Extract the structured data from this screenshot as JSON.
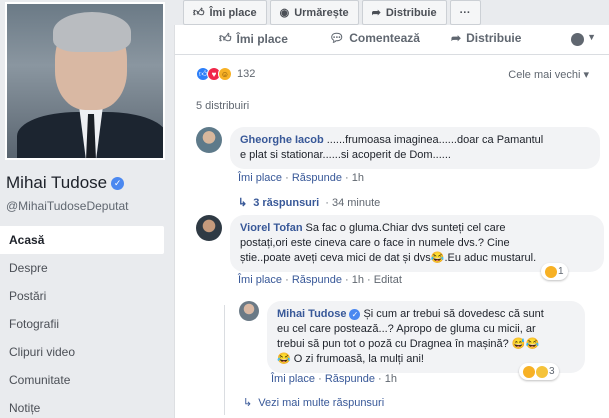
{
  "page": {
    "name": "Mihai Tudose",
    "handle": "@MihaiTudoseDeputat",
    "nav": [
      "Acasă",
      "Despre",
      "Postări",
      "Fotografii",
      "Clipuri video",
      "Comunitate",
      "Notițe"
    ]
  },
  "top_bar": {
    "like": "Îmi place",
    "follow": "Urmărește",
    "share": "Distribuie",
    "more": "···"
  },
  "post": {
    "actions": {
      "like": "Îmi place",
      "comment": "Comentează",
      "share": "Distribuie"
    },
    "reactions_count": "132",
    "sort": "Cele mai vechi ▾",
    "shares": "5 distribuiri"
  },
  "comments": [
    {
      "author": "Gheorghe Iacob",
      "text_line1": "......frumoasa imaginea......doar ca Pamantul",
      "text_line2": "e plat si stationar......si acoperit de Dom......",
      "like": "Îmi place",
      "reply": "Răspunde",
      "time": "1h",
      "replies_link": "3 răspunsuri",
      "replies_time": "· 34 minute"
    },
    {
      "author": "Viorel Tofan",
      "text_line1": "Sa fac o gluma.Chiar dvs sunteți cel care",
      "text_line2": "postați,ori este cineva care o face in numele dvs.? Cine",
      "text_line3": "știe..poate aveți ceva mici de dat și dvs😂.Eu aduc mustarul.",
      "like": "Îmi place",
      "reply": "Răspunde",
      "time": "1h",
      "edited": "Editat",
      "reaction_count": "1"
    },
    {
      "author": "Mihai Tudose",
      "text_line1": "Și cum ar trebui să dovedesc că sunt",
      "text_line2": "eu cel care postează...? Apropo de gluma cu micii, ar",
      "text_line3": "trebui să pun tot o poză cu Dragnea în mașină? 😅😂",
      "text_line4": "😂 O zi frumoasă, la mulți ani!",
      "like": "Îmi place",
      "reply": "Răspunde",
      "time": "1h",
      "reaction_count": "3"
    }
  ],
  "more_replies": "Vezi mai multe răspunsuri",
  "colors": {
    "link": "#385898",
    "accent": "#4b88f0",
    "bg": "#e9ebee"
  }
}
